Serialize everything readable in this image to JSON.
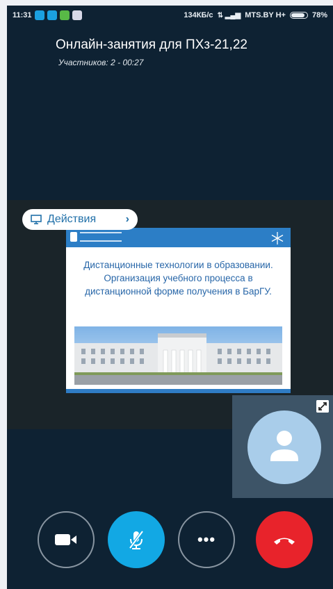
{
  "status_bar": {
    "time": "11:31",
    "network_speed": "134КБ/с",
    "carrier": "MTS.BY H+",
    "battery": "78%",
    "app_icons": [
      "app-icon-s",
      "app-icon-s",
      "app-icon-green",
      "app-icon-viber"
    ]
  },
  "call": {
    "title": "Онлайн-занятия для ПХз-21,22",
    "subtitle": "Участников: 2 - 00:27"
  },
  "actions": {
    "label": "Действия",
    "icon": "monitor-icon",
    "chevron": "›"
  },
  "slide": {
    "text": "Дистанционные технологии в образовании. Организация учебного процесса в дистанционной форме получения в БарГУ."
  },
  "controls": {
    "video_icon": "camera-icon",
    "mute_icon": "mic-muted-icon",
    "more_icon": "more-icon",
    "more_label": "•••",
    "hangup_icon": "hangup-icon"
  },
  "colors": {
    "background": "#0e2233",
    "accent_blue": "#12a8e4",
    "hangup_red": "#e8232b",
    "slide_blue": "#2c7ec6",
    "avatar": "#a9cdea"
  }
}
